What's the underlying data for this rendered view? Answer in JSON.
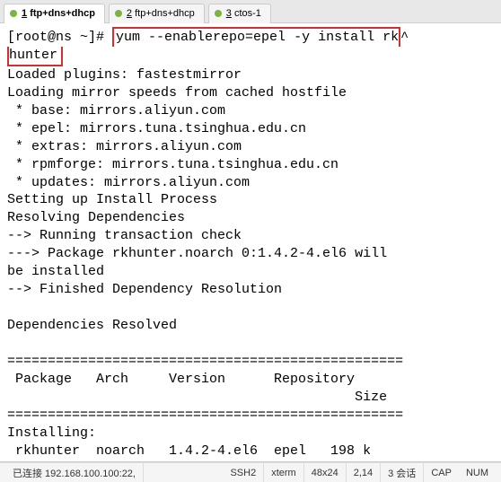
{
  "tabs": [
    {
      "num": "1",
      "label": "ftp+dns+dhcp",
      "active": true
    },
    {
      "num": "2",
      "label": "ftp+dns+dhcp",
      "active": false
    },
    {
      "num": "3",
      "label": "ctos-1",
      "active": false
    }
  ],
  "terminal": {
    "prompt": "[root@ns ~]# ",
    "cmd_part1": "yum --enablerepo=epel -y install rk",
    "cmd_caret": "^",
    "cmd_part2": "hunter",
    "body": "\nLoaded plugins: fastestmirror\nLoading mirror speeds from cached hostfile\n * base: mirrors.aliyun.com\n * epel: mirrors.tuna.tsinghua.edu.cn\n * extras: mirrors.aliyun.com\n * rpmforge: mirrors.tuna.tsinghua.edu.cn\n * updates: mirrors.aliyun.com\nSetting up Install Process\nResolving Dependencies\n--> Running transaction check\n---> Package rkhunter.noarch 0:1.4.2-4.el6 will \nbe installed\n--> Finished Dependency Resolution\n\nDependencies Resolved\n\n=================================================\n Package   Arch     Version      Repository\n                                           Size\n=================================================\nInstalling:\n rkhunter  noarch   1.4.2-4.el6  epel   198 k"
  },
  "status": {
    "conn": "已连接 192.168.100.100:22,",
    "proto": "SSH2",
    "term": "xterm",
    "size": "48x24",
    "pos": "2,14",
    "sess": "3 会话",
    "cap": "CAP",
    "num": "NUM"
  }
}
